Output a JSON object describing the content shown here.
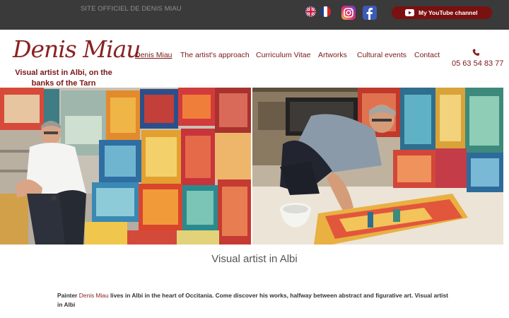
{
  "topbar": {
    "site_official": "SITE OFFICIEL DE DENIS MIAU",
    "youtube_label": "My YouTube channel",
    "colors": {
      "background": "#3a3a3a",
      "youtube_button": "#7a1010"
    },
    "icons": [
      "flag-uk-icon",
      "flag-fr-icon",
      "instagram-icon",
      "facebook-icon",
      "youtube-icon"
    ]
  },
  "header": {
    "logo": "Denis Miau",
    "tagline": "Visual artist in Albi, on the banks of the Tarn",
    "nav": [
      {
        "label": "Denis Miau",
        "active": true
      },
      {
        "label": "The artist's approach",
        "active": false
      },
      {
        "label": "Curriculum Vitae",
        "active": false
      },
      {
        "label": "Artworks",
        "active": false
      },
      {
        "label": "Cultural events",
        "active": false
      },
      {
        "label": "Contact",
        "active": false
      }
    ],
    "phone": "05 63 54 83 77",
    "accent_color": "#7a1616"
  },
  "main": {
    "section_title": "Visual artist in Albi",
    "intro": {
      "prefix": "Painter ",
      "name": "Denis Miau",
      "text": " lives in Albi in the heart of Occitania. Come discover his works, halfway between abstract and figurative art. Visual artist in Albi"
    }
  }
}
